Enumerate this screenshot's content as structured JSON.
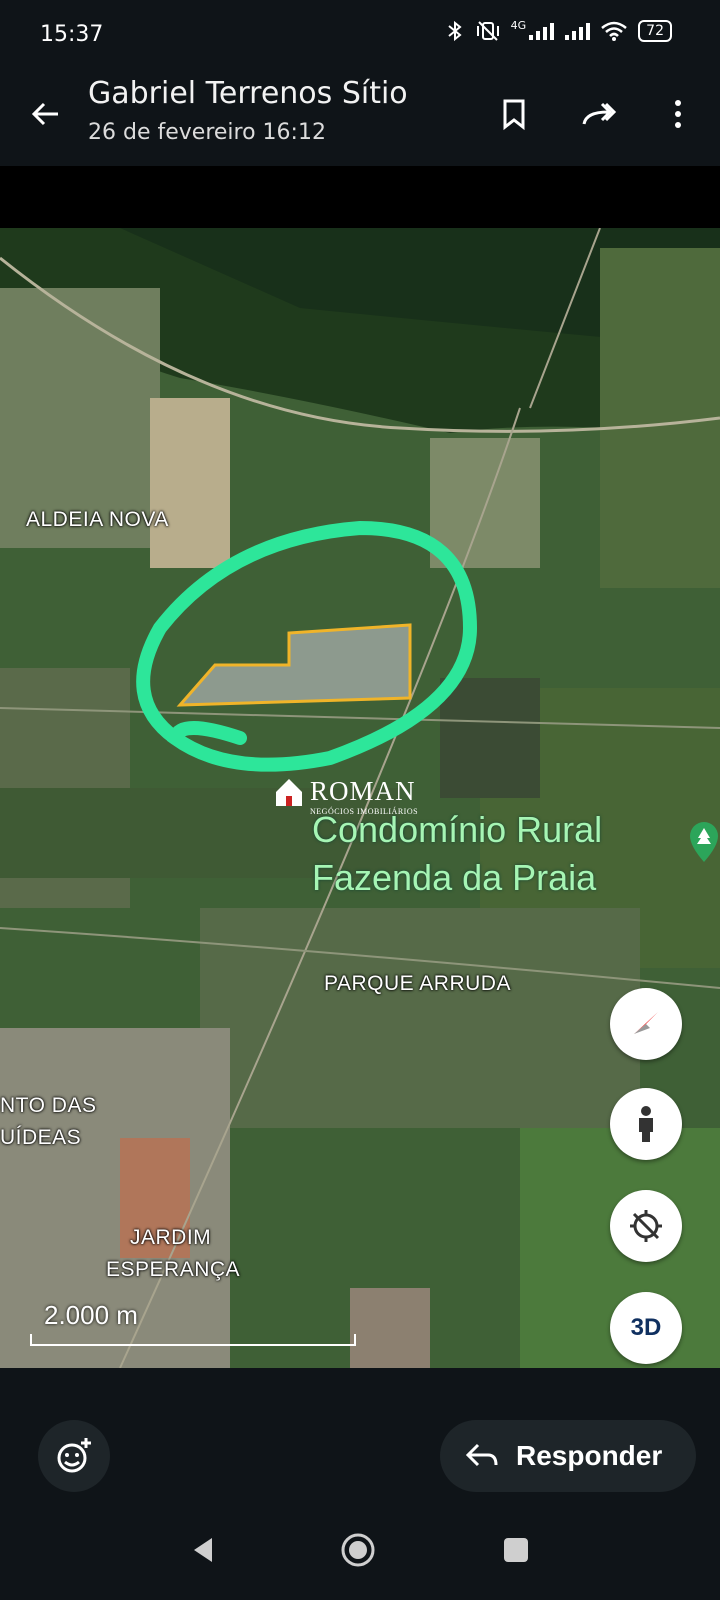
{
  "status_bar": {
    "time": "15:37",
    "network": "4G",
    "battery": "72",
    "icons": [
      "bluetooth-icon",
      "mute-vibrate-icon",
      "signal-icon",
      "signal-icon",
      "wifi-icon",
      "battery-icon"
    ]
  },
  "header": {
    "title": "Gabriel Terrenos Sítio",
    "subtitle": "26 de fevereiro 16:12",
    "icons": [
      "back-arrow-icon",
      "bookmark-icon",
      "forward-icon",
      "more-vert-icon"
    ]
  },
  "map": {
    "labels": {
      "aldeia_nova": "ALDEIA NOVA",
      "condo_line1": "Condomínio Rural",
      "condo_line2": "Fazenda da Praia",
      "parque_arruda": "PARQUE ARRUDA",
      "das_line1": "NTO DAS",
      "das_line2": "UÍDEAS",
      "jardim_line1": "JARDIM",
      "jardim_line2": "ESPERANÇA"
    },
    "watermark": {
      "name": "ROMAN",
      "tagline": "NEGÓCIOS IMOBILIÁRIOS"
    },
    "scale": "2.000 m",
    "controls": {
      "compass": "compass-icon",
      "street_view": "person-icon",
      "location": "location-off-icon",
      "three_d": "3D"
    },
    "colors": {
      "highlight_circle": "#2de69a",
      "parcel_outline": "#f0b429"
    }
  },
  "footer": {
    "reply_label": "Responder",
    "icons": [
      "emoji-add-icon",
      "reply-icon"
    ]
  },
  "nav_bar": {
    "icons": [
      "nav-back-icon",
      "nav-home-icon",
      "nav-recents-icon"
    ]
  }
}
